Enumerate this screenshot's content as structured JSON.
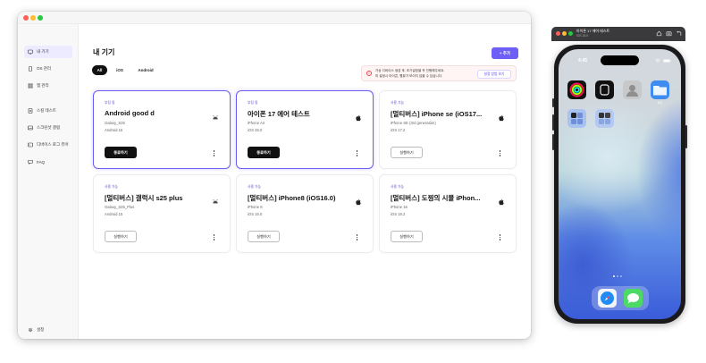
{
  "app": {
    "page_title": "내 기기",
    "add_button": "+ 추가"
  },
  "sidebar": {
    "items": [
      {
        "label": "내 기기",
        "icon": "device-icon",
        "active": true
      },
      {
        "label": "OS 관리",
        "icon": "os-icon",
        "active": false
      },
      {
        "label": "앱 관리",
        "icon": "apps-grid-icon",
        "active": false
      },
      {
        "label": "스킬 테스트",
        "icon": "document-icon",
        "active": false
      },
      {
        "label": "스크린샷 갤럼",
        "icon": "gallery-icon",
        "active": false
      },
      {
        "label": "디바이스 로그 뷰어",
        "icon": "log-icon",
        "active": false
      },
      {
        "label": "FAQ",
        "icon": "faq-icon",
        "active": false
      }
    ],
    "settings_label": "설정"
  },
  "filters": [
    "All",
    "iOS",
    "Android"
  ],
  "notice": {
    "line1": "가상 디바이스 생성 후, 초기설정을 꼭 진행해주세요.",
    "line2": "미 설정시 아이콘, 웹뷰가 보이지 않을 수 있습니다.",
    "button": "설정 방법 보기"
  },
  "devices": [
    {
      "status": "부팅 됨",
      "name": "Android good d",
      "model": "Galaxy_S25",
      "os": "Android 15",
      "platform": "android",
      "action": "종료하기",
      "selected": true
    },
    {
      "status": "부팅 됨",
      "name": "아이폰 17 에어 테스트",
      "model": "iPhone Air",
      "os": "iOS 26.0",
      "platform": "ios",
      "action": "종료하기",
      "selected": true
    },
    {
      "status": "사용 가능",
      "name": "[멀티버스] iPhone se (iOS17...",
      "model": "iPhone SE (3rd generation)",
      "os": "iOS 17.2",
      "platform": "ios",
      "action": "실행하기",
      "selected": false
    },
    {
      "status": "사용 가능",
      "name": "[멀티버스] 갤럭시 s25 plus",
      "model": "Galaxy_S25_Plus",
      "os": "Android 15",
      "platform": "android",
      "action": "실행하기",
      "selected": false
    },
    {
      "status": "사용 가능",
      "name": "[멀티버스] iPhone8 (iOS16.0)",
      "model": "iPhone 8",
      "os": "iOS 16.0",
      "platform": "ios",
      "action": "실행하기",
      "selected": false
    },
    {
      "status": "사용 가능",
      "name": "[멀티버스] 도찡의 시뮬 iPhon...",
      "model": "iPhone 16",
      "os": "iOS 18.2",
      "platform": "ios",
      "action": "실행하기",
      "selected": false
    }
  ],
  "simulator": {
    "title": "아이폰 17 에어 테스트",
    "subtitle": "iOS 26.0",
    "time": "4:45",
    "apps": [
      {
        "name": "Fitness",
        "label": "",
        "color": "#111111",
        "icon": "activity-rings-icon"
      },
      {
        "name": "Watch",
        "label": "",
        "color": "#111111",
        "icon": "watch-icon"
      },
      {
        "name": "Contacts",
        "label": "",
        "color": "#bfbfbf",
        "icon": "contacts-icon"
      },
      {
        "name": "Files",
        "label": "파일",
        "color": "#3f8cf0",
        "icon": "folder-icon"
      },
      {
        "name": "Utilities",
        "label": "",
        "color": "#a9c3f0",
        "icon": "folder-grid-icon"
      },
      {
        "name": "Folder",
        "label": "",
        "color": "#b3c9f2",
        "icon": "folder-grid-icon"
      }
    ],
    "dock": [
      {
        "name": "Safari",
        "icon": "safari-icon"
      },
      {
        "name": "Messages",
        "icon": "messages-icon"
      }
    ]
  },
  "colors": {
    "accent": "#6d5ef5",
    "status_text": "#5b4de8",
    "notice_bg": "#fff5f5",
    "notice_icon": "#e5484d"
  }
}
